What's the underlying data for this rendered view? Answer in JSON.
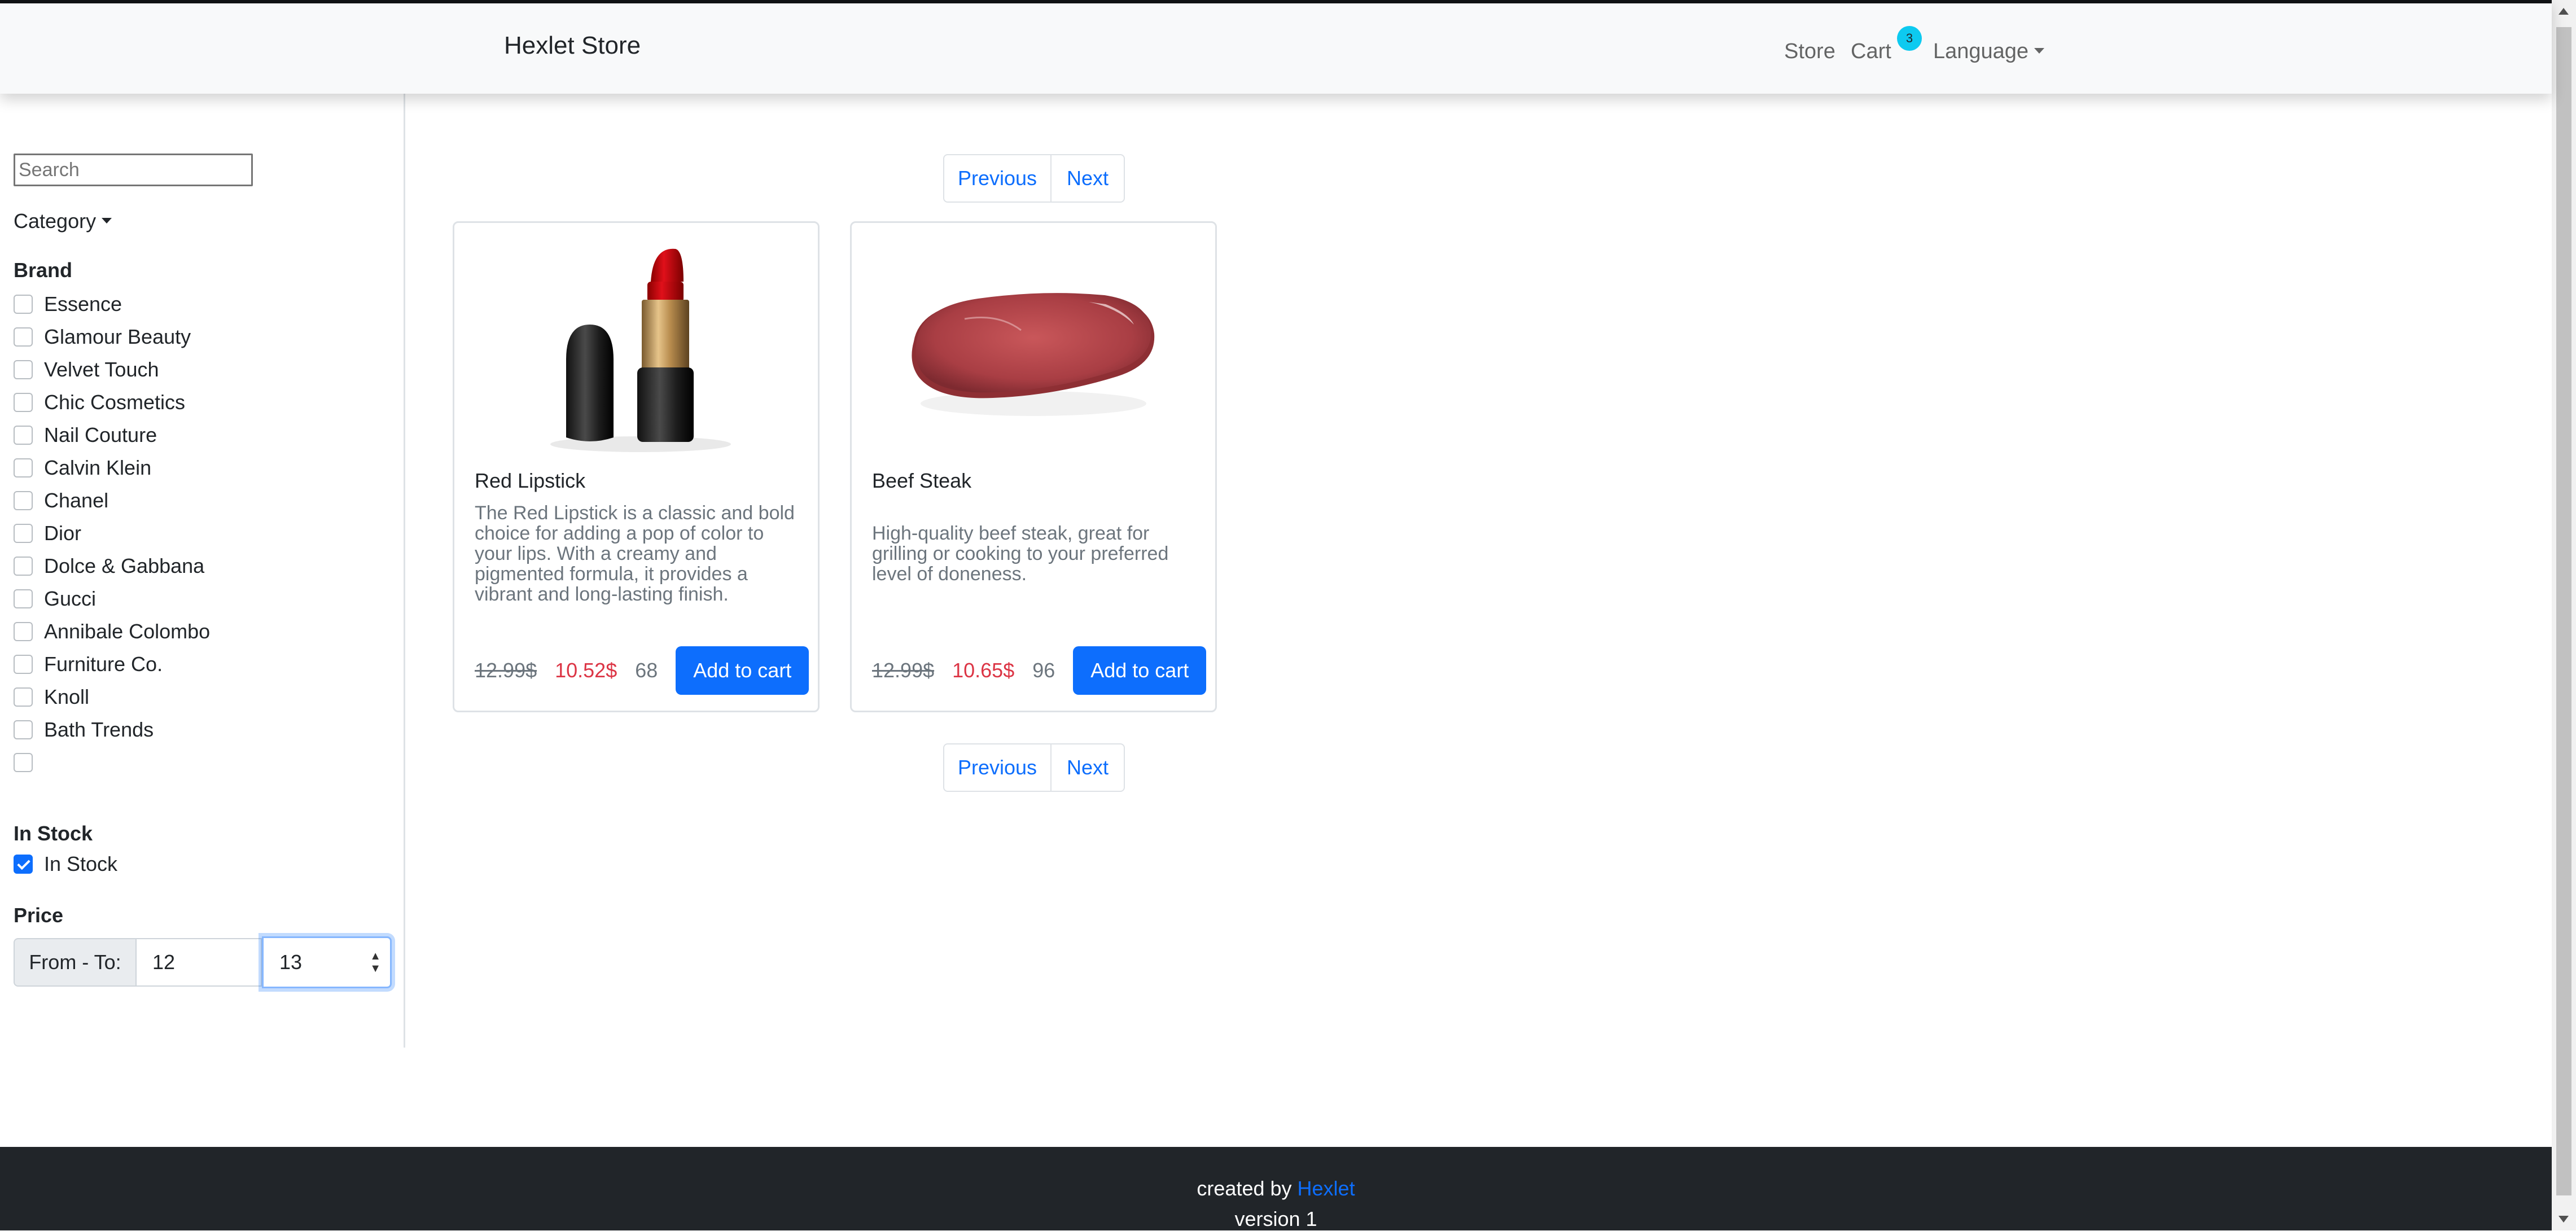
{
  "navbar": {
    "brand": "Hexlet Store",
    "store_label": "Store",
    "cart_label": "Cart",
    "cart_count": "3",
    "language_label": "Language"
  },
  "sidebar": {
    "search_placeholder": "Search",
    "category_label": "Category",
    "brand_title": "Brand",
    "brands": [
      "Essence",
      "Glamour Beauty",
      "Velvet Touch",
      "Chic Cosmetics",
      "Nail Couture",
      "Calvin Klein",
      "Chanel",
      "Dior",
      "Dolce & Gabbana",
      "Gucci",
      "Annibale Colombo",
      "Furniture Co.",
      "Knoll",
      "Bath Trends",
      ""
    ],
    "in_stock_title": "In Stock",
    "in_stock_label": "In Stock",
    "in_stock_checked": true,
    "price_title": "Price",
    "price_range_label": "From - To:",
    "price_from": "12",
    "price_to": "13"
  },
  "pagination": {
    "previous_label": "Previous",
    "next_label": "Next"
  },
  "products": [
    {
      "title": "Red Lipstick",
      "description": "The Red Lipstick is a classic and bold choice for adding a pop of color to your lips. With a creamy and pigmented formula, it provides a vibrant and long-lasting finish.",
      "old_price": "12.99$",
      "new_price": "10.52$",
      "stock": "68",
      "add_label": "Add to cart",
      "image_icon": "lipstick-image"
    },
    {
      "title": "Beef Steak",
      "description": "High-quality beef steak, great for grilling or cooking to your preferred level of doneness.",
      "old_price": "12.99$",
      "new_price": "10.65$",
      "stock": "96",
      "add_label": "Add to cart",
      "image_icon": "steak-image"
    }
  ],
  "footer": {
    "created_by": "created by ",
    "link_label": "Hexlet",
    "version": "version 1"
  },
  "colors": {
    "primary": "#0d6efd",
    "danger": "#dc3545",
    "badge": "#0dcaf0",
    "footer_bg": "#212529",
    "navbar_bg": "#f8f9fa"
  }
}
